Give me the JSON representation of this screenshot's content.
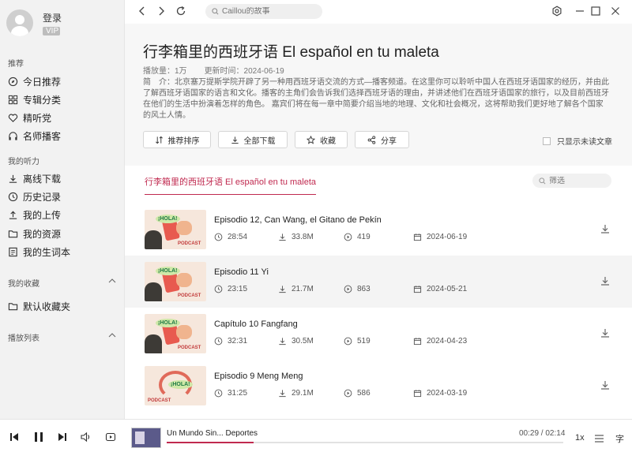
{
  "sidebar": {
    "login_label": "登录",
    "vip_label": "VIP",
    "recommend_title": "推荐",
    "recommend_items": [
      {
        "label": "今日推荐",
        "icon": "compass-icon"
      },
      {
        "label": "专辑分类",
        "icon": "grid-icon"
      },
      {
        "label": "精听党",
        "icon": "heart-icon"
      },
      {
        "label": "名师播客",
        "icon": "headphones-icon"
      }
    ],
    "mine_title": "我的听力",
    "mine_items": [
      {
        "label": "离线下载",
        "icon": "download-icon"
      },
      {
        "label": "历史记录",
        "icon": "clock-icon"
      },
      {
        "label": "我的上传",
        "icon": "upload-icon"
      },
      {
        "label": "我的资源",
        "icon": "folder-icon"
      },
      {
        "label": "我的生词本",
        "icon": "notebook-icon"
      }
    ],
    "favorites_title": "我的收藏",
    "favorites_items": [
      {
        "label": "默认收藏夹",
        "icon": "folder-icon"
      }
    ],
    "playlist_title": "播放列表"
  },
  "topbar": {
    "search_placeholder": "Caillou的故事"
  },
  "album": {
    "title": "行李箱里的西班牙语 El español en tu maleta",
    "plays": "播放量：1万",
    "updated": "更新时间：2024-06-19",
    "description": "简　介：北京塞万提斯学院开辟了另一种用西班牙语交流的方式—播客频道。在这里你可以聆听中国人在西班牙语国家的经历，并由此了解西班牙语国家的语言和文化。播客的主角们会告诉我们选择西班牙语的理由，并讲述他们在西班牙语国家的旅行，以及目前西班牙在他们的生活中扮演着怎样的角色。 嘉宾们将在每一章中简要介绍当地的地理、文化和社会概况，这将帮助我们更好地了解各个国家的风土人情。",
    "actions": {
      "sort": "推荐排序",
      "download_all": "全部下载",
      "collect": "收藏",
      "share": "分享"
    },
    "unread_only": "只显示未读文章"
  },
  "tabs": {
    "active": "行李箱里的西班牙语 El español en tu maleta",
    "filter_placeholder": "筛选"
  },
  "episodes": [
    {
      "title": "Episodio 12, Can Wang, el Gitano de Pekín",
      "duration": "28:54",
      "size": "33.8M",
      "plays": "419",
      "date": "2024-06-19"
    },
    {
      "title": "Episodio 11 Yi",
      "duration": "23:15",
      "size": "21.7M",
      "plays": "863",
      "date": "2024-05-21"
    },
    {
      "title": "Capítulo 10 Fangfang",
      "duration": "32:31",
      "size": "30.5M",
      "plays": "519",
      "date": "2024-04-23"
    },
    {
      "title": "Episodio 9 Meng Meng",
      "duration": "31:25",
      "size": "29.1M",
      "plays": "586",
      "date": "2024-03-19"
    }
  ],
  "player": {
    "title": "Un Mundo Sin... Deportes",
    "time": "00:29 / 02:14",
    "progress": 0.22,
    "speed": "1x",
    "lyric": "字"
  },
  "colors": {
    "accent": "#c0294f"
  }
}
